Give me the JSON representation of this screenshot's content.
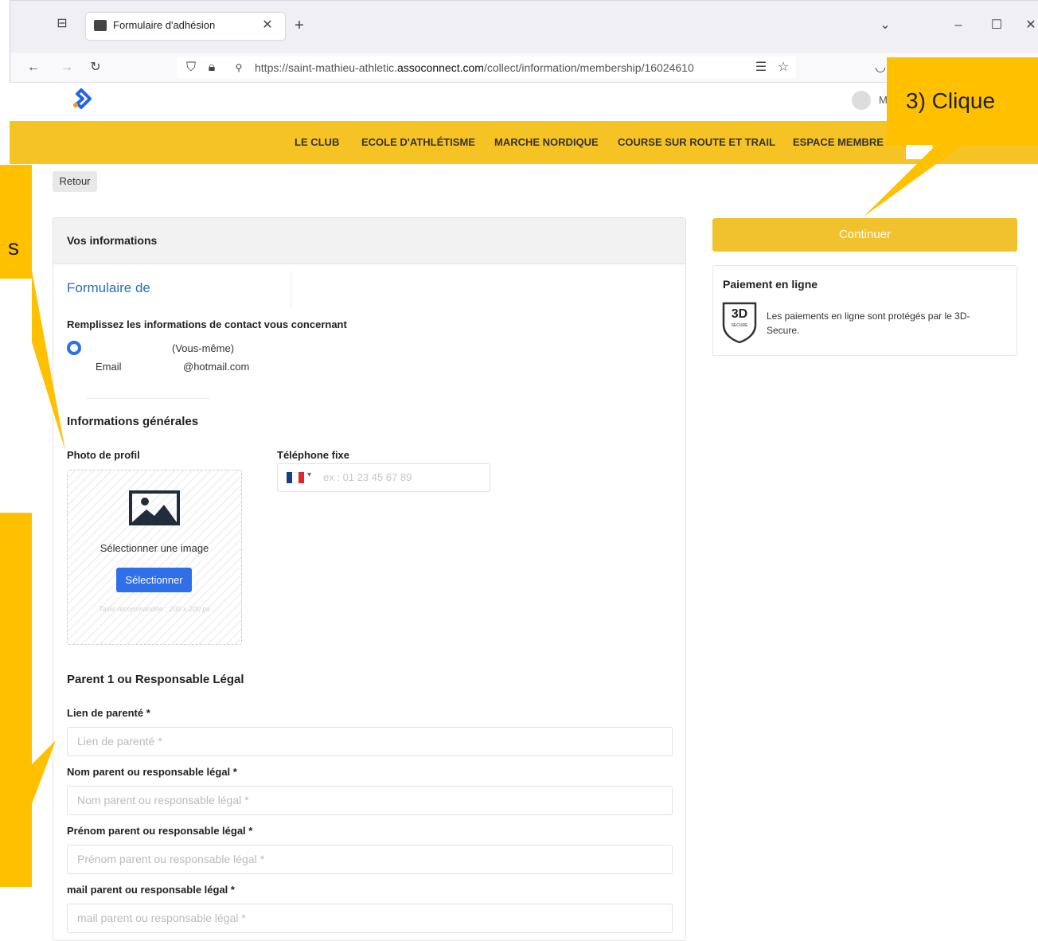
{
  "browser": {
    "tab_title": "Formulaire d'adhésion",
    "url_prefix": "https://saint-mathieu-athletic.",
    "url_domain": "assoconnect.com",
    "url_path": "/collect/information/membership/16024610"
  },
  "site": {
    "user_initial": "M",
    "nav": [
      "LE CLUB",
      "ECOLE D'ATHLÉTISME",
      "MARCHE NORDIQUE",
      "COURSE SUR ROUTE ET TRAIL",
      "ESPACE MEMBRE"
    ]
  },
  "page": {
    "back_label": "Retour",
    "card_title": "Vos informations",
    "form_title": "Formulaire de",
    "contact_heading": "Remplissez les informations de contact vous concernant",
    "self_label": "(Vous-même)",
    "email_label": "Email",
    "email_value": "@hotmail.com",
    "general_heading": "Informations générales",
    "photo_label": "Photo de profil",
    "photo_select_text": "Sélectionner une image",
    "photo_select_button": "Sélectionner",
    "photo_hint": "Taille recommandée : 200 x 200 px",
    "phone_label": "Téléphone fixe",
    "phone_placeholder": "ex : 01 23 45 67 89",
    "parent_heading": "Parent 1 ou Responsable Légal",
    "fields": [
      {
        "label": "Lien de parenté *",
        "placeholder": "Lien de parenté *"
      },
      {
        "label": "Nom parent ou responsable légal *",
        "placeholder": "Nom parent ou responsable légal *"
      },
      {
        "label": "Prénom parent ou responsable légal *",
        "placeholder": "Prénom parent ou responsable légal *"
      },
      {
        "label": "mail parent ou responsable légal *",
        "placeholder": "mail parent ou responsable légal *"
      }
    ]
  },
  "sidebar": {
    "continue_label": "Continuer",
    "payment_title": "Paiement en ligne",
    "badge_text": "3D",
    "badge_sub": "SECURE",
    "payment_text_1": "Les paiements en ligne sont protégés par le 3D-",
    "payment_text_2": "Secure."
  },
  "callouts": {
    "top_right": "3) Clique",
    "left_top": "s"
  },
  "colors": {
    "nav_bg": "#f6c324",
    "callout": "#ffc000",
    "primary_button": "#2f6fe8",
    "continue_button": "#f2c12e",
    "link_blue": "#2e6db4"
  },
  "icons": [
    "tab-overview-icon",
    "favicon-icon",
    "close-icon",
    "plus-icon",
    "chevron-down-icon",
    "minimize-icon",
    "maximize-icon",
    "back-arrow-icon",
    "forward-arrow-icon",
    "reload-icon",
    "shield-icon",
    "lock-icon",
    "reader-icon",
    "star-icon",
    "pocket-icon",
    "logo-icon",
    "user-icon",
    "radio-icon",
    "image-placeholder-icon",
    "france-flag-icon",
    "3d-secure-icon"
  ]
}
